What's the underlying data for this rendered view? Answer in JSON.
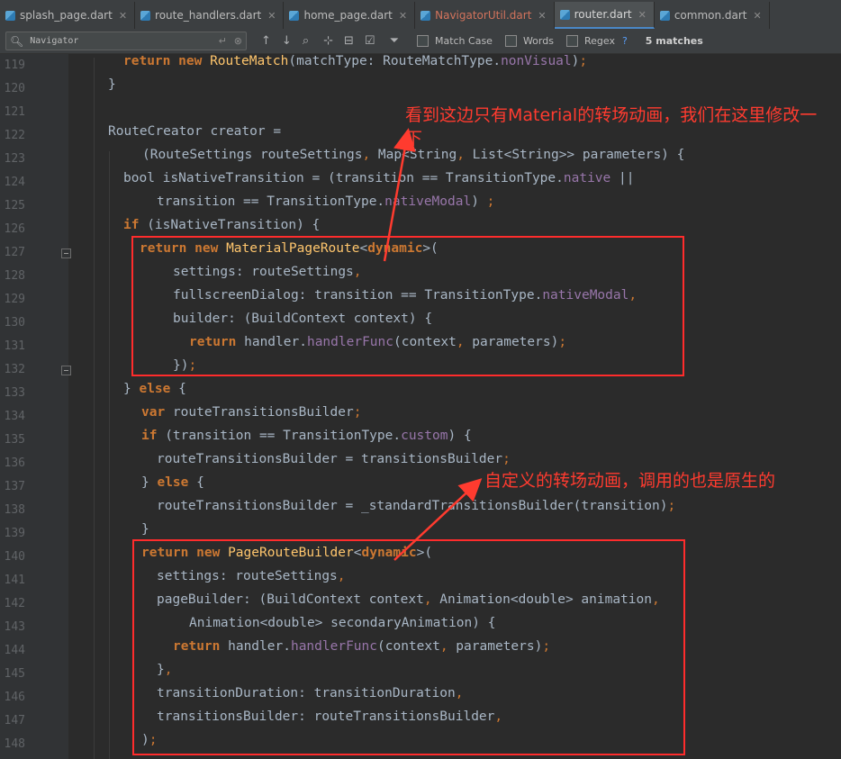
{
  "tabs": [
    {
      "label": "splash_page.dart",
      "active": false,
      "warn": false
    },
    {
      "label": "route_handlers.dart",
      "active": false,
      "warn": false
    },
    {
      "label": "home_page.dart",
      "active": false,
      "warn": false
    },
    {
      "label": "NavigatorUtil.dart",
      "active": false,
      "warn": true
    },
    {
      "label": "router.dart",
      "active": true,
      "warn": false
    },
    {
      "label": "common.dart",
      "active": false,
      "warn": false
    }
  ],
  "search": {
    "query": "Navigator",
    "match_case_label": "Match Case",
    "words_label": "Words",
    "regex_label": "Regex",
    "help_label": "?",
    "matches_label": "5 matches"
  },
  "line_numbers": [
    "119",
    "120",
    "121",
    "122",
    "123",
    "124",
    "125",
    "126",
    "127",
    "128",
    "129",
    "130",
    "131",
    "132",
    "133",
    "134",
    "135",
    "136",
    "137",
    "138",
    "139",
    "140",
    "141",
    "142",
    "143",
    "144",
    "145",
    "146",
    "147",
    "148"
  ],
  "annotations": {
    "top": "看到这边只有Material的转场动画，我们在这里修改一下",
    "middle": "自定义的转场动画，调用的也是原生的"
  },
  "colors": {
    "keyword": "#cc7832",
    "function": "#ffc66d",
    "enum": "#9876aa",
    "text": "#a9b7c6",
    "annotation": "#ff3b2f",
    "highlight_box": "#ff2c2c"
  }
}
